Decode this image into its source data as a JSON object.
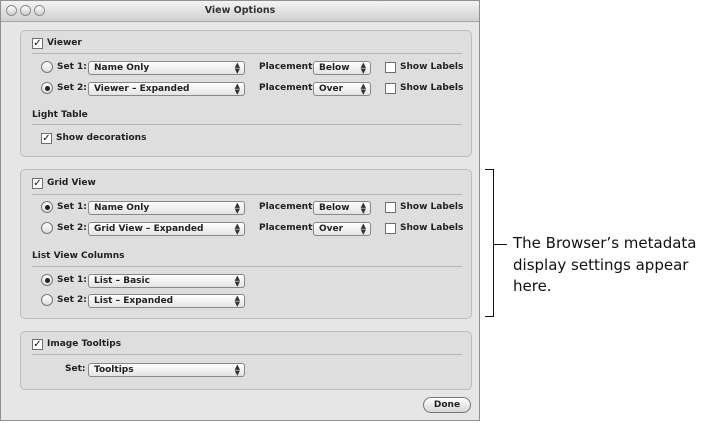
{
  "window": {
    "title": "View Options"
  },
  "viewer": {
    "label": "Viewer",
    "checked": true,
    "sets": [
      {
        "label": "Set 1:",
        "selected": false,
        "value": "Name Only",
        "placement_label": "Placement:",
        "placement": "Below",
        "show_labels": "Show Labels"
      },
      {
        "label": "Set 2:",
        "selected": true,
        "value": "Viewer – Expanded",
        "placement_label": "Placement:",
        "placement": "Over",
        "show_labels": "Show Labels"
      }
    ]
  },
  "light_table": {
    "title": "Light Table",
    "show_decorations": "Show decorations"
  },
  "grid_view": {
    "label": "Grid View",
    "checked": true,
    "sets": [
      {
        "label": "Set 1:",
        "selected": true,
        "value": "Name Only",
        "placement_label": "Placement:",
        "placement": "Below",
        "show_labels": "Show Labels"
      },
      {
        "label": "Set 2:",
        "selected": false,
        "value": "Grid View – Expanded",
        "placement_label": "Placement:",
        "placement": "Over",
        "show_labels": "Show Labels"
      }
    ]
  },
  "list_view": {
    "title": "List View Columns",
    "sets": [
      {
        "label": "Set 1:",
        "selected": true,
        "value": "List – Basic"
      },
      {
        "label": "Set 2:",
        "selected": false,
        "value": "List – Expanded"
      }
    ]
  },
  "tooltips": {
    "label": "Image Tooltips",
    "checked": true,
    "set_label": "Set:",
    "value": "Tooltips"
  },
  "done_label": "Done",
  "callout": "The Browser’s metadata display settings appear here."
}
